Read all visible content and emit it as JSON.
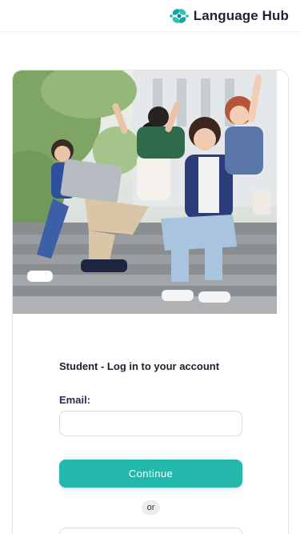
{
  "header": {
    "brand_name": "Language Hub",
    "logo_icon": "language-hub-logo-icon",
    "brand_color": "#23b8ab"
  },
  "hero": {
    "image_icon": "students-on-steps-photo"
  },
  "login": {
    "title": "Student - Log in to your account",
    "email_label": "Email:",
    "email_value": "",
    "email_placeholder": "",
    "continue_label": "Continue",
    "divider_text": "or"
  },
  "colors": {
    "accent": "#23b8ab",
    "label_text": "#2a2a52",
    "divider_bg": "#ececf0"
  }
}
